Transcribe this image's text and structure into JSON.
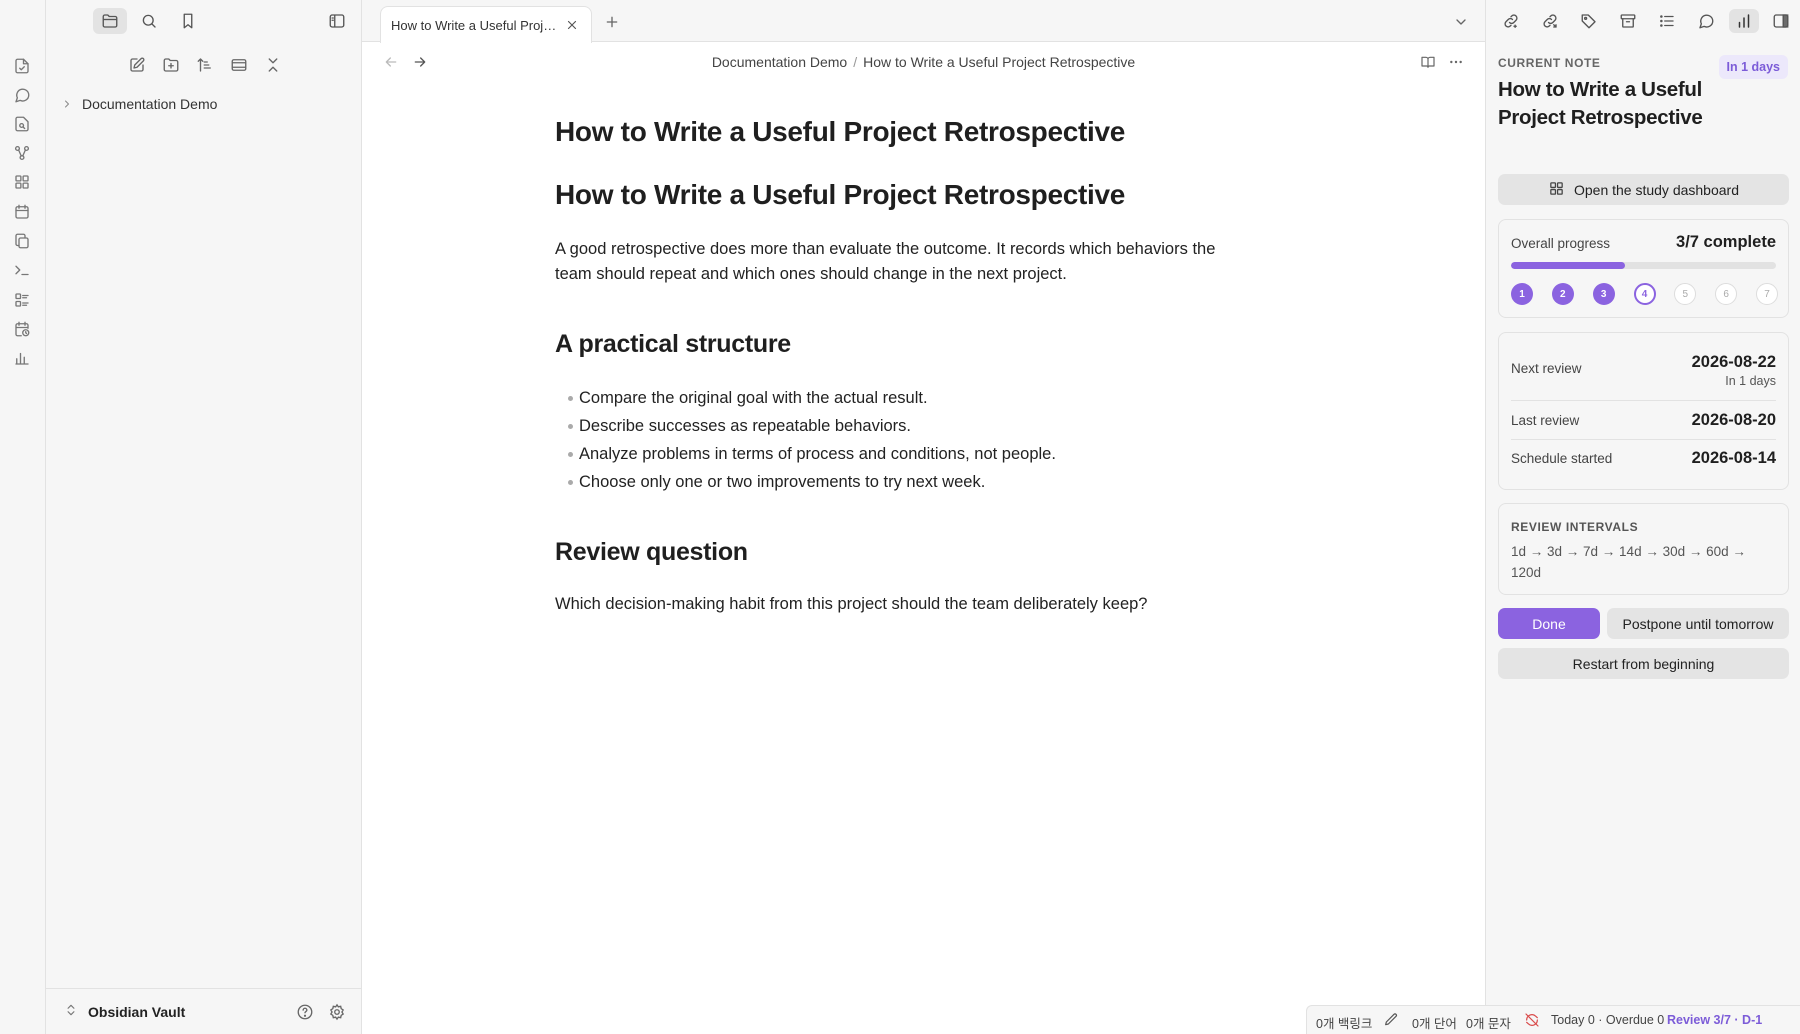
{
  "colors": {
    "accent": "#8b63e0",
    "accent_text": "#7c5cd8",
    "sync_error": "#d94b4b"
  },
  "ribbon": {
    "icons": [
      "daily-note-icon",
      "chat-icon",
      "file-search-icon",
      "graph-icon",
      "layout-grid-icon",
      "calendar-icon",
      "copy-icon",
      "terminal-icon",
      "list-checks-icon",
      "calendar-clock-icon",
      "bar-chart-icon"
    ]
  },
  "sidebar": {
    "tabs": [
      "files-tab",
      "search-tab",
      "bookmarks-tab"
    ],
    "tree": [
      {
        "label": "Documentation Demo"
      }
    ],
    "vault_name": "Obsidian Vault"
  },
  "tab": {
    "title": "How to Write a Useful Project Retrospective"
  },
  "breadcrumb": {
    "folder": "Documentation Demo",
    "separator": "/",
    "note": "How to Write a Useful Project Retrospective"
  },
  "document": {
    "title": "How to Write a Useful Project Retrospective",
    "h1": "How to Write a Useful Project Retrospective",
    "intro_line1": "A good retrospective does more than evaluate the outcome. It records which behaviors the",
    "intro_line2": "team should repeat and which ones should change in the next project.",
    "h2_structure": "A practical structure",
    "bullets": [
      "Compare the original goal with the actual result.",
      "Describe successes as repeatable behaviors.",
      "Analyze problems in terms of process and conditions, not people.",
      "Choose only one or two improvements to try next week."
    ],
    "h2_review": "Review question",
    "review_text": "Which decision-making habit from this project should the team deliberately keep?"
  },
  "review_panel": {
    "label": "CURRENT NOTE",
    "badge": "In 1 days",
    "note_title": "How to Write a Useful Project Retrospective",
    "dashboard_button": "Open the study dashboard",
    "progress": {
      "label": "Overall progress",
      "value": "3/7 complete",
      "completed": 3,
      "total": 7,
      "steps": [
        "1",
        "2",
        "3",
        "4",
        "5",
        "6",
        "7"
      ],
      "current_step": 4
    },
    "next_review": {
      "label": "Next review",
      "date": "2026-08-22",
      "relative": "In 1 days"
    },
    "last_review": {
      "label": "Last review",
      "date": "2026-08-20"
    },
    "schedule_started": {
      "label": "Schedule started",
      "date": "2026-08-14"
    },
    "intervals": {
      "label": "REVIEW INTERVALS",
      "text": "1d → 3d → 7d → 14d → 30d → 60d → 120d"
    },
    "done_button": "Done",
    "postpone_button": "Postpone until tomorrow",
    "restart_button": "Restart from beginning"
  },
  "statusbar": {
    "backlinks": "0개 백링크",
    "words": "0개 단어",
    "chars": "0개 문자",
    "due": "Today 0 · Overdue 0",
    "review": "Review 3/7 · D-1"
  }
}
